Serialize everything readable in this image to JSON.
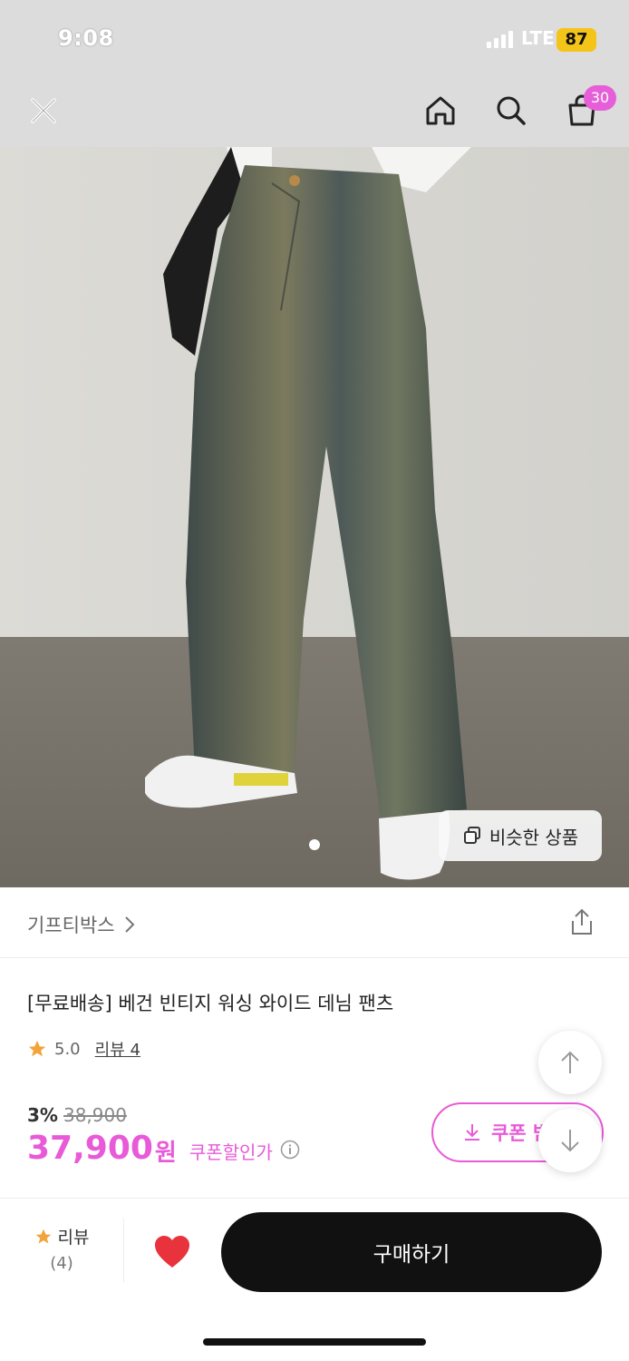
{
  "status_bar": {
    "time": "9:08",
    "network": "LTE",
    "battery": "87"
  },
  "nav": {
    "close_icon": "close-icon",
    "home_icon": "home-icon",
    "search_icon": "search-icon",
    "cart_icon": "shopping-bag-icon",
    "cart_count": "30"
  },
  "product": {
    "image_count": 1,
    "similar_products_label": "비슷한 상품",
    "brand": "기프티박스",
    "brand_chevron": "›",
    "title": "[무료배송] 베건 빈티지 워싱 와이드 데님 팬츠",
    "rating": "5.0",
    "review_label": "리뷰 4",
    "discount_rate": "3%",
    "original_price": "38,900",
    "sale_price": "37,900",
    "currency": "원",
    "coupon_price_label": "쿠폰할인가",
    "coupon_button_label": "쿠폰 받"
  },
  "bottom_bar": {
    "review_label": "리뷰",
    "review_count": "(4)",
    "buy_label": "구매하기"
  },
  "colors": {
    "accent": "#e85ad8",
    "heart": "#e8323c",
    "star": "#f2a33a",
    "buy_button": "#111111"
  }
}
